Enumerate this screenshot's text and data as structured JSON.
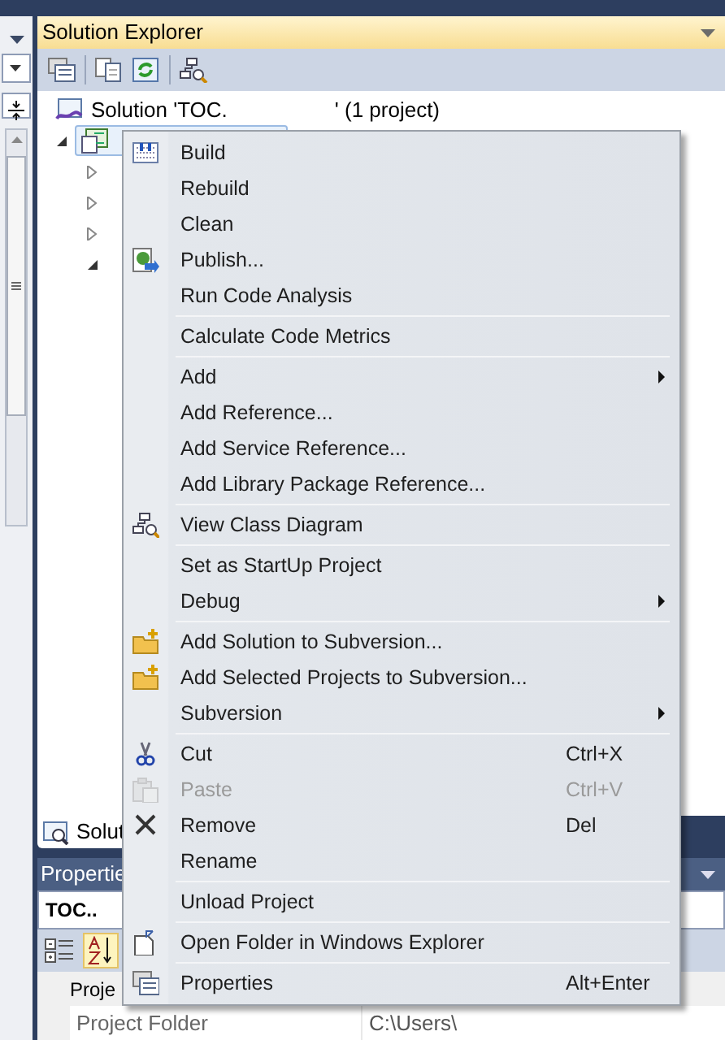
{
  "solution_explorer": {
    "title": "Solution Explorer",
    "tree": [
      {
        "label_start": "Solution 'TOC.",
        "label_end": "' (1 project)",
        "children": [
          {
            "selected": true,
            "expanded": true,
            "children": [
              {
                "expanded": false
              },
              {
                "expanded": false
              },
              {
                "expanded": false
              },
              {
                "expanded": true
              }
            ]
          }
        ]
      }
    ],
    "bottom_tab": "Solut"
  },
  "properties": {
    "title": "Propertie",
    "object": "TOC..",
    "alphabetical": true,
    "rows": [
      {
        "name": "Proje",
        "kind": "category"
      },
      {
        "name": "Project Folder",
        "value": "C:\\Users\\",
        "kind": "property"
      }
    ]
  },
  "context_menu": {
    "items": [
      {
        "kind": "item",
        "label": "Build",
        "disabled": false,
        "submenu": false
      },
      {
        "kind": "item",
        "label": "Rebuild",
        "disabled": false,
        "submenu": false
      },
      {
        "kind": "item",
        "label": "Clean",
        "disabled": false,
        "submenu": false
      },
      {
        "kind": "item",
        "label": "Publish...",
        "disabled": false,
        "submenu": false
      },
      {
        "kind": "item",
        "label": "Run Code Analysis",
        "disabled": false,
        "submenu": false
      },
      {
        "kind": "separator"
      },
      {
        "kind": "item",
        "label": "Calculate Code Metrics",
        "disabled": false,
        "submenu": false
      },
      {
        "kind": "separator"
      },
      {
        "kind": "item",
        "label": "Add",
        "disabled": false,
        "submenu": true
      },
      {
        "kind": "item",
        "label": "Add Reference...",
        "disabled": false,
        "submenu": false
      },
      {
        "kind": "item",
        "label": "Add Service Reference...",
        "disabled": false,
        "submenu": false
      },
      {
        "kind": "item",
        "label": "Add Library Package Reference...",
        "disabled": false,
        "submenu": false
      },
      {
        "kind": "separator"
      },
      {
        "kind": "item",
        "label": "View Class Diagram",
        "disabled": false,
        "submenu": false
      },
      {
        "kind": "separator"
      },
      {
        "kind": "item",
        "label": "Set as StartUp Project",
        "disabled": false,
        "submenu": false
      },
      {
        "kind": "item",
        "label": "Debug",
        "disabled": false,
        "submenu": true
      },
      {
        "kind": "separator"
      },
      {
        "kind": "item",
        "label": "Add Solution to Subversion...",
        "disabled": false,
        "submenu": false
      },
      {
        "kind": "item",
        "label": "Add Selected Projects to Subversion...",
        "disabled": false,
        "submenu": false
      },
      {
        "kind": "item",
        "label": "Subversion",
        "disabled": false,
        "submenu": true
      },
      {
        "kind": "separator"
      },
      {
        "kind": "item",
        "label": "Cut",
        "shortcut": "Ctrl+X",
        "disabled": false,
        "submenu": false
      },
      {
        "kind": "item",
        "label": "Paste",
        "shortcut": "Ctrl+V",
        "disabled": true,
        "submenu": false
      },
      {
        "kind": "item",
        "label": "Remove",
        "shortcut": "Del",
        "disabled": false,
        "submenu": false
      },
      {
        "kind": "item",
        "label": "Rename",
        "disabled": false,
        "submenu": false
      },
      {
        "kind": "separator"
      },
      {
        "kind": "item",
        "label": "Unload Project",
        "disabled": false,
        "submenu": false
      },
      {
        "kind": "separator"
      },
      {
        "kind": "item",
        "label": "Open Folder in Windows Explorer",
        "disabled": false,
        "submenu": false
      },
      {
        "kind": "separator"
      },
      {
        "kind": "item",
        "label": "Properties",
        "shortcut": "Alt+Enter",
        "disabled": false,
        "submenu": false
      }
    ]
  }
}
